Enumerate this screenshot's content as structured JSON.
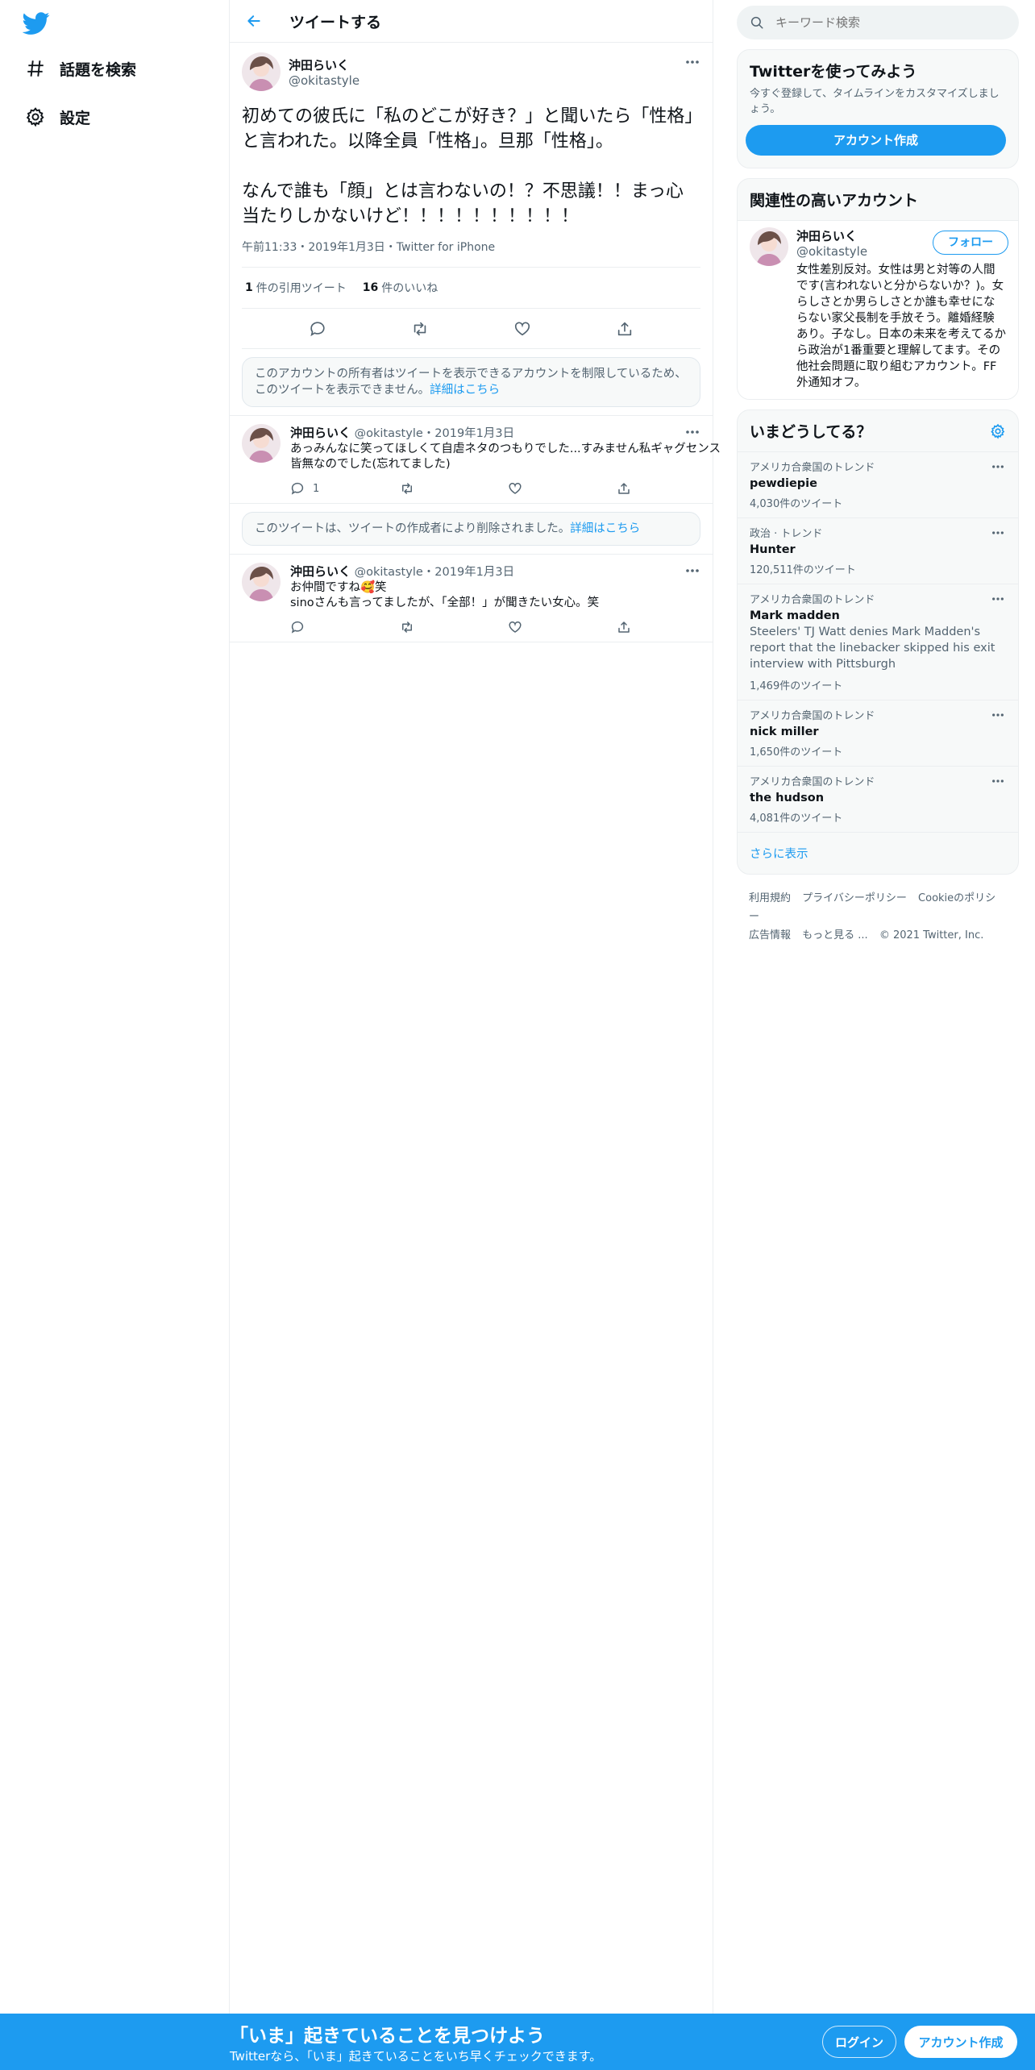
{
  "nav": {
    "explore_label": "話題を検索",
    "settings_label": "設定"
  },
  "header": {
    "title": "ツイートする"
  },
  "focal_tweet": {
    "name": "沖田らいく",
    "handle": "@okitastyle",
    "text": "初めての彼氏に「私のどこが好き？」と聞いたら「性格」と言われた。以降全員「性格」。旦那「性格」。\n\nなんで誰も「顔」とは言わないの！？不思議！！まっ心当たりしかないけど！！！！！！！！！！",
    "meta": "午前11:33・2019年1月3日・Twitter for iPhone",
    "quote_count": "1",
    "quote_label": "件の引用ツイート",
    "like_count": "16",
    "like_label": "件のいいね"
  },
  "notice_restricted": {
    "text": "このアカウントの所有者はツイートを表示できるアカウントを制限しているため、このツイートを表示できません。",
    "link": "詳細はこちら"
  },
  "reply_1": {
    "name": "沖田らいく",
    "handle": "@okitastyle",
    "date": "・2019年1月3日",
    "text": "あっみんなに笑ってほしくて自虐ネタのつもりでした...すみません私ギャグセンス皆無なのでした(忘れてました)",
    "reply_count": "1"
  },
  "notice_deleted": {
    "text": "このツイートは、ツイートの作成者により削除されました。",
    "link": "詳細はこちら"
  },
  "reply_2": {
    "name": "沖田らいく",
    "handle": "@okitastyle",
    "date": "・2019年1月3日",
    "text": "お仲間ですね🥰笑\nsinoさんも言ってましたが、「全部！」が聞きたい女心。笑"
  },
  "search": {
    "placeholder": "キーワード検索"
  },
  "signup_card": {
    "title": "Twitterを使ってみよう",
    "subtitle": "今すぐ登録して、タイムラインをカスタマイズしましょう。",
    "button": "アカウント作成"
  },
  "related": {
    "title": "関連性の高いアカウント",
    "name": "沖田らいく",
    "handle": "@okitastyle",
    "follow": "フォロー",
    "bio": "女性差別反対。女性は男と対等の人間です(言われないと分からないか？)。女らしさとか男らしさとか誰も幸せにならない家父長制を手放そう。離婚経験あり。子なし。日本の未来を考えてるから政治が1番重要と理解してます。その他社会問題に取り組むアカウント。FF外通知オフ。"
  },
  "trends": {
    "title": "いまどうしてる？",
    "items": [
      {
        "context": "アメリカ合衆国のトレンド",
        "name": "pewdiepie",
        "count": "4,030件のツイート"
      },
      {
        "context": "政治 · トレンド",
        "name": "Hunter",
        "count": "120,511件のツイート"
      },
      {
        "context": "アメリカ合衆国のトレンド",
        "name": "Mark madden",
        "desc": "Steelers' TJ Watt denies Mark Madden's report that the linebacker skipped his exit interview with Pittsburgh",
        "count": "1,469件のツイート"
      },
      {
        "context": "アメリカ合衆国のトレンド",
        "name": "nick miller",
        "count": "1,650件のツイート"
      },
      {
        "context": "アメリカ合衆国のトレンド",
        "name": "the hudson",
        "count": "4,081件のツイート"
      }
    ],
    "show_more": "さらに表示"
  },
  "footer": {
    "terms": "利用規約",
    "privacy": "プライバシーポリシー",
    "cookie": "Cookieのポリシー",
    "ads": "広告情報",
    "more": "もっと見る ...",
    "copyright": "© 2021 Twitter, Inc."
  },
  "banner": {
    "title": "「いま」起きていることを見つけよう",
    "subtitle": "Twitterなら、「いま」起きていることをいち早くチェックできます。",
    "login": "ログイン",
    "signup": "アカウント作成"
  },
  "colors": {
    "accent": "#1d9bf0",
    "text": "#0f1419",
    "secondary": "#536471"
  }
}
